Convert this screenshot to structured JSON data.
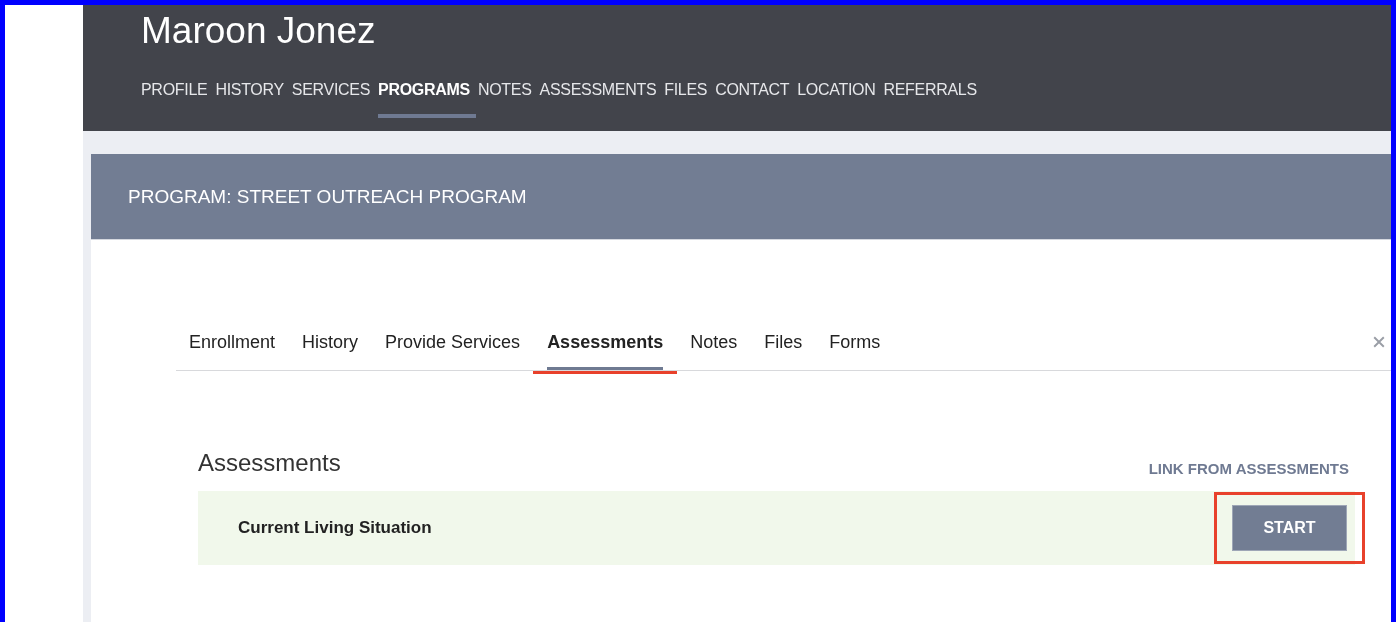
{
  "client_name": "Maroon Jonez",
  "nav": [
    {
      "label": "PROFILE",
      "selected": false
    },
    {
      "label": "HISTORY",
      "selected": false
    },
    {
      "label": "SERVICES",
      "selected": false
    },
    {
      "label": "PROGRAMS",
      "selected": true
    },
    {
      "label": "NOTES",
      "selected": false
    },
    {
      "label": "ASSESSMENTS",
      "selected": false
    },
    {
      "label": "FILES",
      "selected": false
    },
    {
      "label": "CONTACT",
      "selected": false
    },
    {
      "label": "LOCATION",
      "selected": false
    },
    {
      "label": "REFERRALS",
      "selected": false
    }
  ],
  "program_title": "PROGRAM: STREET OUTREACH PROGRAM",
  "tabs": [
    {
      "label": "Enrollment",
      "selected": false,
      "annotated": false
    },
    {
      "label": "History",
      "selected": false,
      "annotated": false
    },
    {
      "label": "Provide Services",
      "selected": false,
      "annotated": false
    },
    {
      "label": "Assessments",
      "selected": true,
      "annotated": true
    },
    {
      "label": "Notes",
      "selected": false,
      "annotated": false
    },
    {
      "label": "Files",
      "selected": false,
      "annotated": false
    },
    {
      "label": "Forms",
      "selected": false,
      "annotated": false
    }
  ],
  "section": {
    "heading": "Assessments",
    "link": "LINK FROM ASSESSMENTS"
  },
  "assessments": [
    {
      "name": "Current Living Situation",
      "button": "START",
      "annotated": true
    }
  ]
}
